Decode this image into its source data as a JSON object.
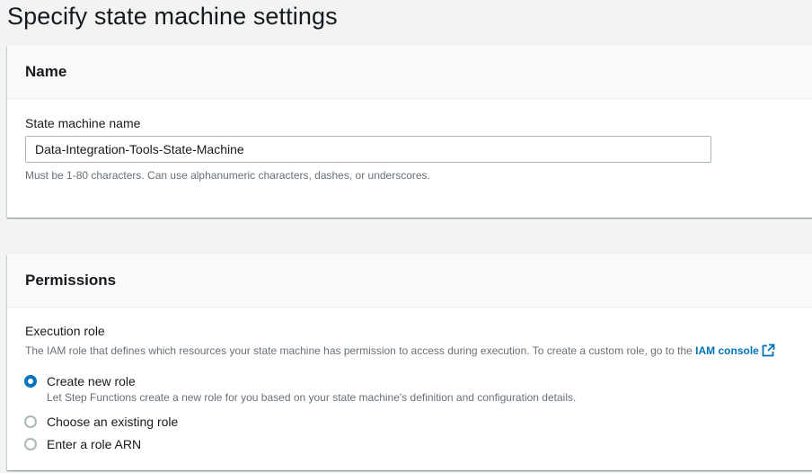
{
  "page": {
    "title": "Specify state machine settings"
  },
  "name_section": {
    "heading": "Name",
    "field_label": "State machine name",
    "field_value": "Data-Integration-Tools-State-Machine",
    "hint": "Must be 1-80 characters. Can use alphanumeric characters, dashes, or underscores."
  },
  "permissions_section": {
    "heading": "Permissions",
    "execution_role_label": "Execution role",
    "execution_role_desc": "The IAM role that defines which resources your state machine has permission to access during execution. To create a custom role, go to the",
    "iam_console_link": "IAM console",
    "options": [
      {
        "label": "Create new role",
        "description": "Let Step Functions create a new role for you based on your state machine's definition and configuration details.",
        "selected": true
      },
      {
        "label": "Choose an existing role",
        "selected": false
      },
      {
        "label": "Enter a role ARN",
        "selected": false
      }
    ]
  },
  "colors": {
    "accent": "#0073bb",
    "background": "#f2f3f3",
    "hint_text": "#687078"
  },
  "icons": {
    "external_link": "external-link-icon"
  }
}
